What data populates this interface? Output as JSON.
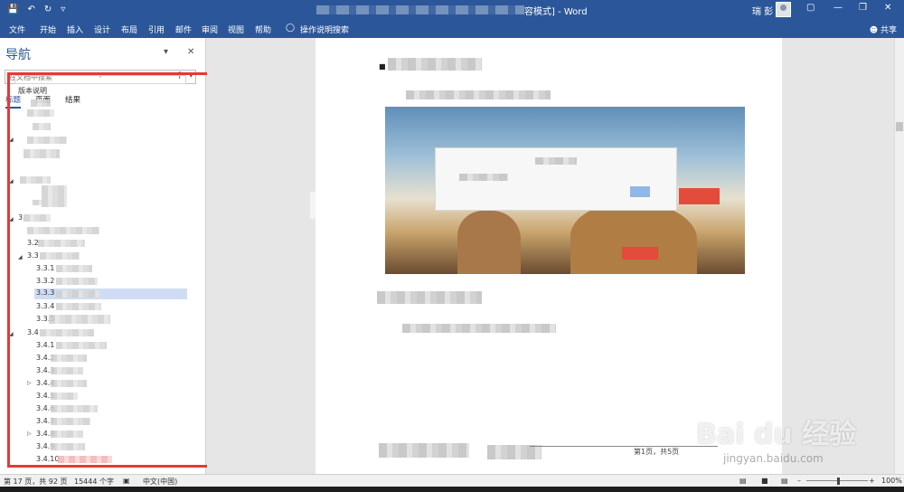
{
  "window": {
    "title_suffix": "容模式] - Word",
    "user": "瑞 彭"
  },
  "ribbon": {
    "tabs": [
      "文件",
      "开始",
      "插入",
      "设计",
      "布局",
      "引用",
      "邮件",
      "审阅",
      "视图",
      "帮助"
    ],
    "tell_me": "操作说明搜索",
    "share": "共享"
  },
  "nav": {
    "title": "导航",
    "search_placeholder": "在文档中搜索",
    "tabs": [
      "标题",
      "页面",
      "结果"
    ],
    "tree": {
      "first": "版本说明",
      "items": [
        {
          "label": "3.",
          "level": 0
        },
        {
          "label": "3.2",
          "level": 1
        },
        {
          "label": "3.3",
          "level": 1
        },
        {
          "label": "3.3.1",
          "level": 2
        },
        {
          "label": "3.3.2",
          "level": 2
        },
        {
          "label": "3.3.3",
          "level": 2
        },
        {
          "label": "3.3.4",
          "level": 2
        },
        {
          "label": "3.3.5",
          "level": 2
        },
        {
          "label": "3.4",
          "level": 1
        },
        {
          "label": "3.4.1",
          "level": 2
        },
        {
          "label": "3.4.2",
          "level": 2
        },
        {
          "label": "3.4.3",
          "level": 2
        },
        {
          "label": "3.4.4",
          "level": 2
        },
        {
          "label": "3.4.5",
          "level": 2
        },
        {
          "label": "3.4.6",
          "level": 2
        },
        {
          "label": "3.4.7",
          "level": 2
        },
        {
          "label": "3.4.8",
          "level": 2
        },
        {
          "label": "3.4.9",
          "level": 2
        },
        {
          "label": "3.4.10",
          "level": 2
        }
      ]
    }
  },
  "document": {
    "footer_page": "第1页，共5页"
  },
  "status": {
    "page": "第 17 页，共 92 页",
    "words": "15444 个字",
    "language": "中文(中国)",
    "zoom": "100%"
  },
  "watermark": {
    "brand": "Bai du 经验",
    "url": "jingyan.baidu.com"
  }
}
